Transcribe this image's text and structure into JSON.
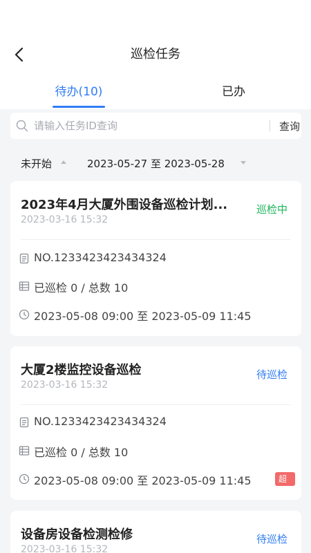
{
  "nav": {
    "title": "巡检任务"
  },
  "tabs": [
    {
      "label": "待办(10)",
      "active": true
    },
    {
      "label": "已办",
      "active": false
    }
  ],
  "search": {
    "placeholder": "请输入任务ID查询",
    "button": "查询"
  },
  "filters": {
    "status": "未开始",
    "date_range": "2023-05-27 至 2023-05-28"
  },
  "colors": {
    "accent": "#2f7cf6",
    "in_progress": "#1bb45a",
    "pending": "#2f7cf6",
    "overtime": "#f26a6a"
  },
  "tasks": [
    {
      "title": "2023年4月大厦外围设备巡检计划...",
      "created": "2023-03-16 15:32",
      "status": "巡检中",
      "status_color": "#1bb45a",
      "number": "NO.1233423423434324",
      "progress": "已巡检 0 / 总数 10",
      "time_range": "2023-05-08 09:00 至 2023-05-09 11:45",
      "badge": ""
    },
    {
      "title": "大厦2楼监控设备巡检",
      "created": "2023-03-16 15:32",
      "status": "待巡检",
      "status_color": "#2f7cf6",
      "number": "NO.1233423423434324",
      "progress": "已巡检 0 / 总数 10",
      "time_range": "2023-05-08 09:00 至 2023-05-09 11:45",
      "badge": "超时"
    },
    {
      "title": "设备房设备检测检修",
      "created": "2023-03-16 15:32",
      "status": "待巡检",
      "status_color": "#2f7cf6"
    }
  ]
}
